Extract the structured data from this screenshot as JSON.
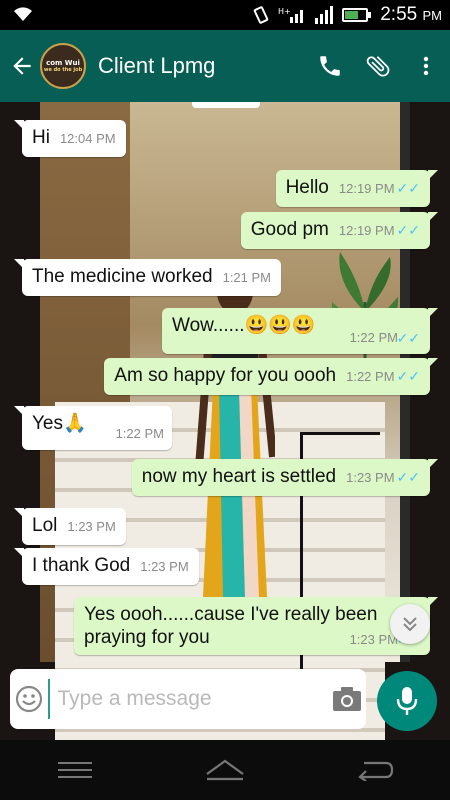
{
  "status_bar": {
    "time": "2:55",
    "ampm": "PM"
  },
  "header": {
    "contact_name": "Client Lpmg",
    "avatar_text_top": "com Wui",
    "avatar_text_bottom": "we do the job"
  },
  "messages": [
    {
      "dir": "in",
      "text": "Hi",
      "time": "12:04 PM"
    },
    {
      "dir": "out",
      "text": "Hello",
      "time": "12:19 PM",
      "ticks": "✓✓"
    },
    {
      "dir": "out",
      "text": "Good pm",
      "time": "12:19 PM",
      "ticks": "✓✓"
    },
    {
      "dir": "in",
      "text": "The medicine worked",
      "time": "1:21 PM"
    },
    {
      "dir": "out",
      "text": "Wow......😃😃😃",
      "time": "1:22 PM",
      "ticks": "✓✓"
    },
    {
      "dir": "out",
      "text": "Am so happy for you oooh",
      "time": "1:22 PM",
      "ticks": "✓✓"
    },
    {
      "dir": "in",
      "text": "Yes🙏",
      "time": "1:22 PM"
    },
    {
      "dir": "out",
      "text": "now my heart is settled",
      "time": "1:23 PM",
      "ticks": "✓✓"
    },
    {
      "dir": "in",
      "text": "Lol",
      "time": "1:23 PM"
    },
    {
      "dir": "in",
      "text": "I thank God",
      "time": "1:23 PM"
    },
    {
      "dir": "out",
      "text": "Yes oooh......cause I've really been praying for you",
      "time": "1:23 PM",
      "ticks": "✓✓"
    }
  ],
  "composer": {
    "placeholder": "Type a message"
  },
  "icons": {
    "back": "arrow-left-icon",
    "call": "phone-icon",
    "attach": "paperclip-icon",
    "menu": "more-vert-icon",
    "emoji": "smiley-icon",
    "camera": "camera-icon",
    "mic": "mic-icon",
    "scroll": "chevron-double-down-icon"
  },
  "colors": {
    "header": "#075e54",
    "outgoing": "#dcf8c6",
    "incoming": "#ffffff",
    "tick": "#4fc3f7",
    "mic": "#00897b"
  }
}
